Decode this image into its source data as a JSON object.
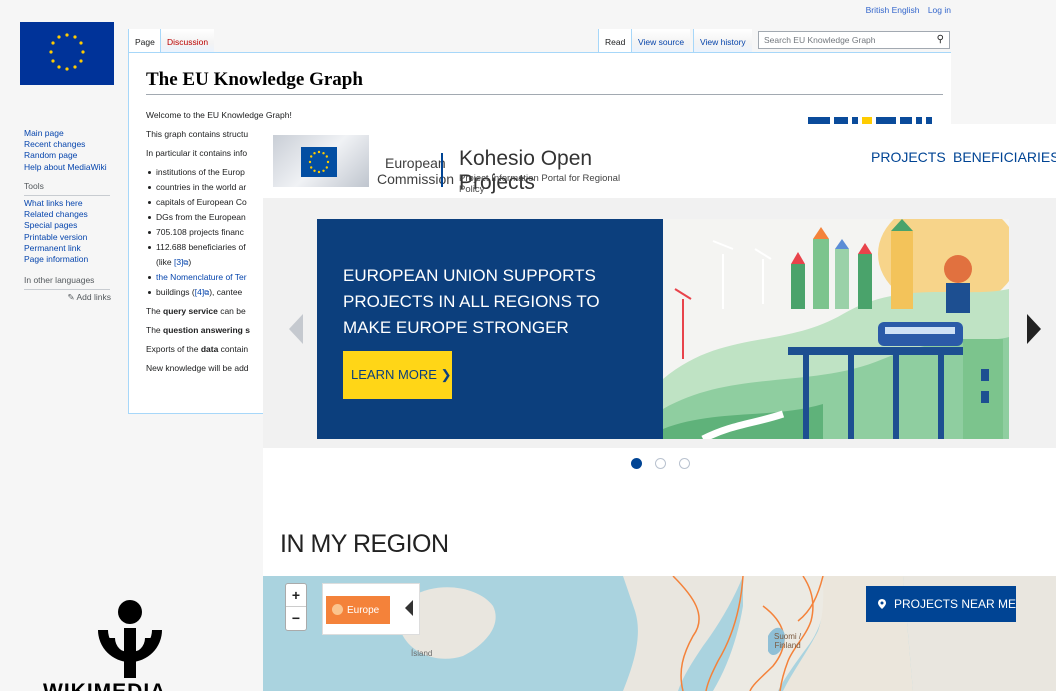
{
  "wiki": {
    "personal_tools": {
      "language": "British English",
      "login": "Log in"
    },
    "tabs": {
      "page": "Page",
      "discussion": "Discussion",
      "read": "Read",
      "view_source": "View source",
      "view_history": "View history"
    },
    "search": {
      "placeholder": "Search EU Knowledge Graph"
    },
    "sidebar": {
      "main_page": "Main page",
      "recent_changes": "Recent changes",
      "random_page": "Random page",
      "help": "Help about MediaWiki",
      "tools_title": "Tools",
      "what_links_here": "What links here",
      "related_changes": "Related changes",
      "special_pages": "Special pages",
      "printable_version": "Printable version",
      "permanent_link": "Permanent link",
      "page_information": "Page information",
      "languages_title": "In other languages",
      "add_links": "Add links"
    },
    "title": "The EU Knowledge Graph",
    "body": {
      "welcome": "Welcome to the EU Knowledge Graph!",
      "contains": "This graph contains structu",
      "in_particular": "In particular it contains info",
      "bullets": [
        "institutions of the Europ",
        "countries in the world ar",
        "capitals of European Co",
        "DGs from the European",
        "705.108 projects financ",
        "112.688 beneficiaries of"
      ],
      "like_prefix": "(like ",
      "like_ref": "[3]",
      "like_suffix": ")",
      "nomenclature": "the Nomenclature of Ter",
      "buildings_prefix": "buildings (",
      "buildings_ref": "[4]",
      "buildings_suffix": "), cantee",
      "query_prefix": "The ",
      "query_bold": "query service",
      "query_rest": " can be",
      "qa_prefix": "The ",
      "qa_bold": "question answering s",
      "exports_prefix": "Exports of the ",
      "exports_bold": "data",
      "exports_rest": " contain",
      "new_knowledge": "New knowledge will be add"
    },
    "footer_logo_text": "WIKIMEDIA"
  },
  "kohesio": {
    "ec_logo_line1": "European",
    "ec_logo_line2": "Commission",
    "app_title": "Kohesio Open Projects",
    "app_subtitle": "Project Information Portal for Regional Policy",
    "nav": {
      "projects": "PROJECTS",
      "beneficiaries": "BENEFICIARIES"
    },
    "hero": {
      "title": "EUROPEAN UNION SUPPORTS PROJECTS IN ALL REGIONS TO MAKE EUROPE STRONGER",
      "cta": "LEARN MORE",
      "cta_icon": "chevron-right-icon",
      "slides_count": 3,
      "active_slide": 1
    },
    "region": {
      "title": "IN MY REGION",
      "zoom_in": "+",
      "zoom_out": "−",
      "europe_button": "Europe",
      "near_me_button": "PROJECTS NEAR ME",
      "map_labels": {
        "iceland": "Ísland",
        "finland_line1": "Suomi /",
        "finland_line2": "Finland"
      }
    },
    "colors": {
      "eu_blue": "#004494",
      "hero_blue": "#0c3f7d",
      "accent_yellow": "#ffd617",
      "map_orange": "#f4823a"
    }
  }
}
